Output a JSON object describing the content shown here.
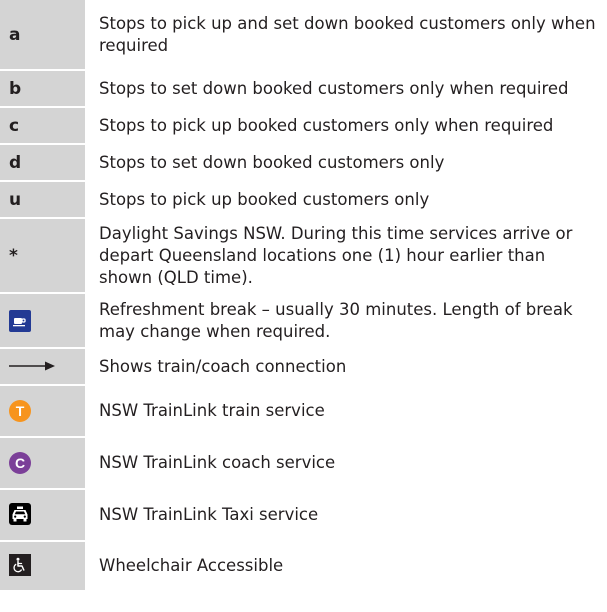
{
  "rows": [
    {
      "symbol": "a",
      "text": "Stops to pick up and set down booked customers only when required"
    },
    {
      "symbol": "b",
      "text": "Stops to set down booked customers only when required"
    },
    {
      "symbol": "c",
      "text": "Stops to pick up booked customers only when required"
    },
    {
      "symbol": "d",
      "text": "Stops to set down booked customers only"
    },
    {
      "symbol": "u",
      "text": "Stops to pick up booked customers only"
    },
    {
      "symbol": "*",
      "text": "Daylight Savings NSW. During this time services arrive or depart Queensland locations one (1) hour earlier than shown (QLD time)."
    },
    {
      "icon": "refreshment-cup-icon",
      "text": "Refreshment break – usually 30 minutes. Length of break may change when required."
    },
    {
      "icon": "right-arrow-icon",
      "text": "Shows train/coach connection"
    },
    {
      "icon": "train-service-icon",
      "icon_letter": "T",
      "text": "NSW TrainLink train service"
    },
    {
      "icon": "coach-service-icon",
      "icon_letter": "C",
      "text": "NSW TrainLink coach service"
    },
    {
      "icon": "taxi-icon",
      "text": "NSW TrainLink Taxi service"
    },
    {
      "icon": "wheelchair-icon",
      "text": "Wheelchair Accessible"
    }
  ],
  "colors": {
    "symbol_cell_bg": "#d4d4d4",
    "train": "#f7941d",
    "coach": "#7b3f98",
    "refreshment": "#233a94",
    "taxi": "#000000"
  }
}
